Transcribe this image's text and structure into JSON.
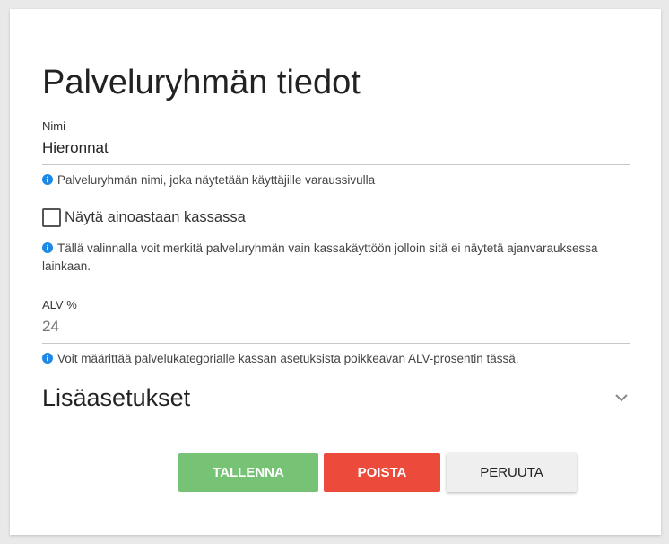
{
  "form": {
    "title": "Palveluryhmän tiedot",
    "name_field": {
      "label": "Nimi",
      "value": "Hieronnat",
      "hint": "Palveluryhmän nimi, joka näytetään käyttäjille varaussivulla"
    },
    "checkout_only": {
      "label": "Näytä ainoastaan kassassa",
      "checked": false,
      "hint": "Tällä valinnalla voit merkitä palveluryhmän vain kassakäyttöön jolloin sitä ei näytetä ajanvarauksessa lainkaan."
    },
    "vat_field": {
      "label": "ALV %",
      "placeholder": "24",
      "hint": "Voit määrittää palvelukategorialle kassan asetuksista poikkeavan ALV-prosentin tässä."
    },
    "advanced_section": {
      "title": "Lisäasetukset",
      "icon": "chevron-down-icon"
    }
  },
  "actions": {
    "save_label": "TALLENNA",
    "delete_label": "POISTA",
    "cancel_label": "PERUUTA"
  },
  "colors": {
    "info_icon": "#1e88e5",
    "save_button": "#77c376",
    "delete_button": "#ec4b3c",
    "cancel_button": "#efefef"
  }
}
